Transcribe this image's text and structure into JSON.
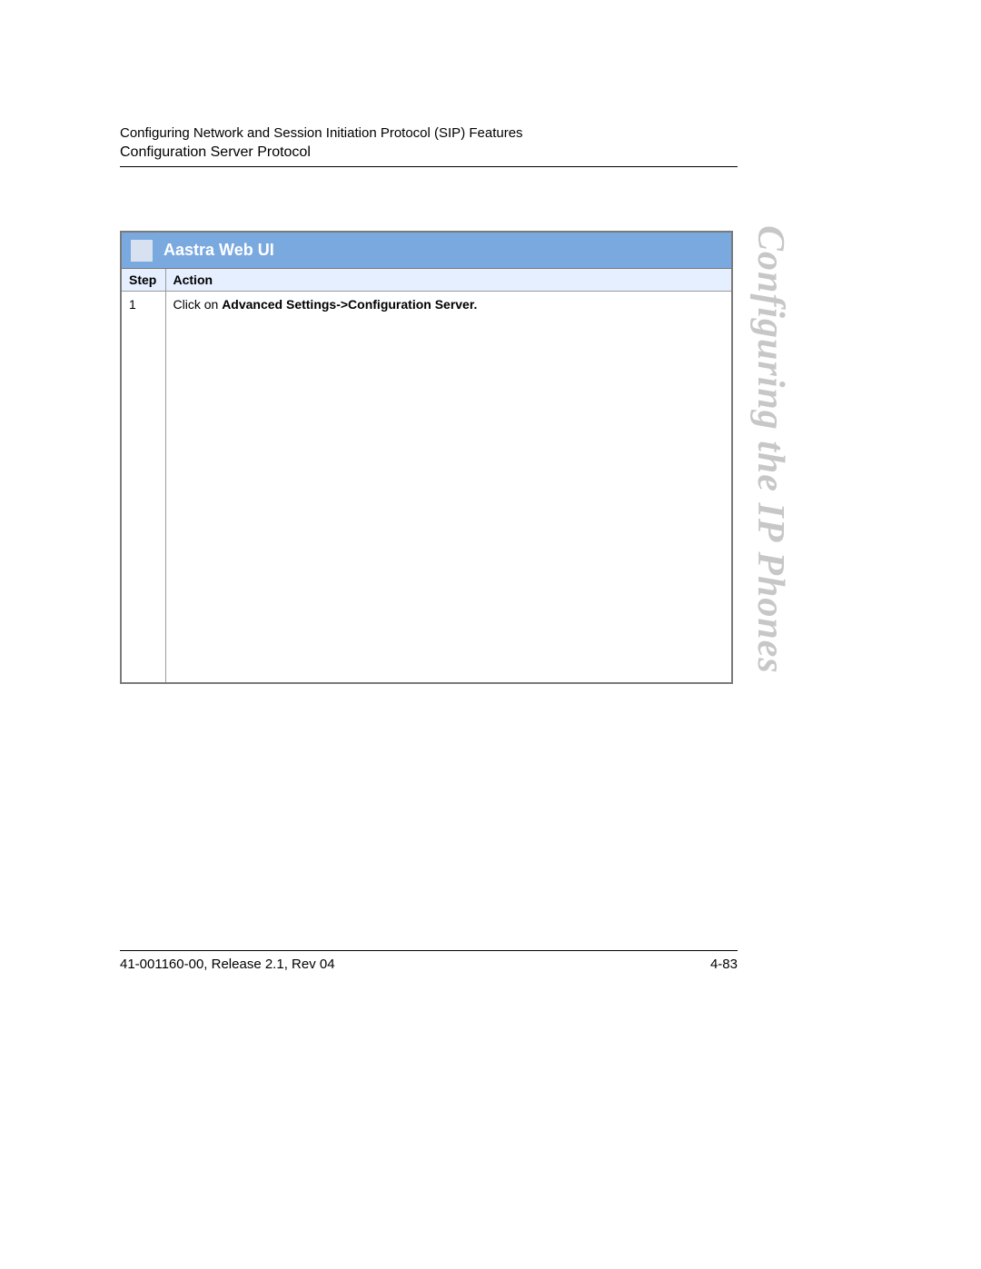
{
  "header": {
    "line1": "Configuring Network and Session Initiation Protocol (SIP) Features",
    "line2": "Configuration Server Protocol"
  },
  "box": {
    "title": "Aastra Web UI",
    "columns": {
      "step": "Step",
      "action": "Action"
    },
    "rows": [
      {
        "step": "1",
        "action_prefix": "Click on ",
        "action_bold": "Advanced Settings->Configuration Server."
      }
    ]
  },
  "side_text": "Configuring the IP Phones",
  "footer": {
    "left": "41-001160-00, Release 2.1, Rev 04",
    "right": "4-83"
  }
}
